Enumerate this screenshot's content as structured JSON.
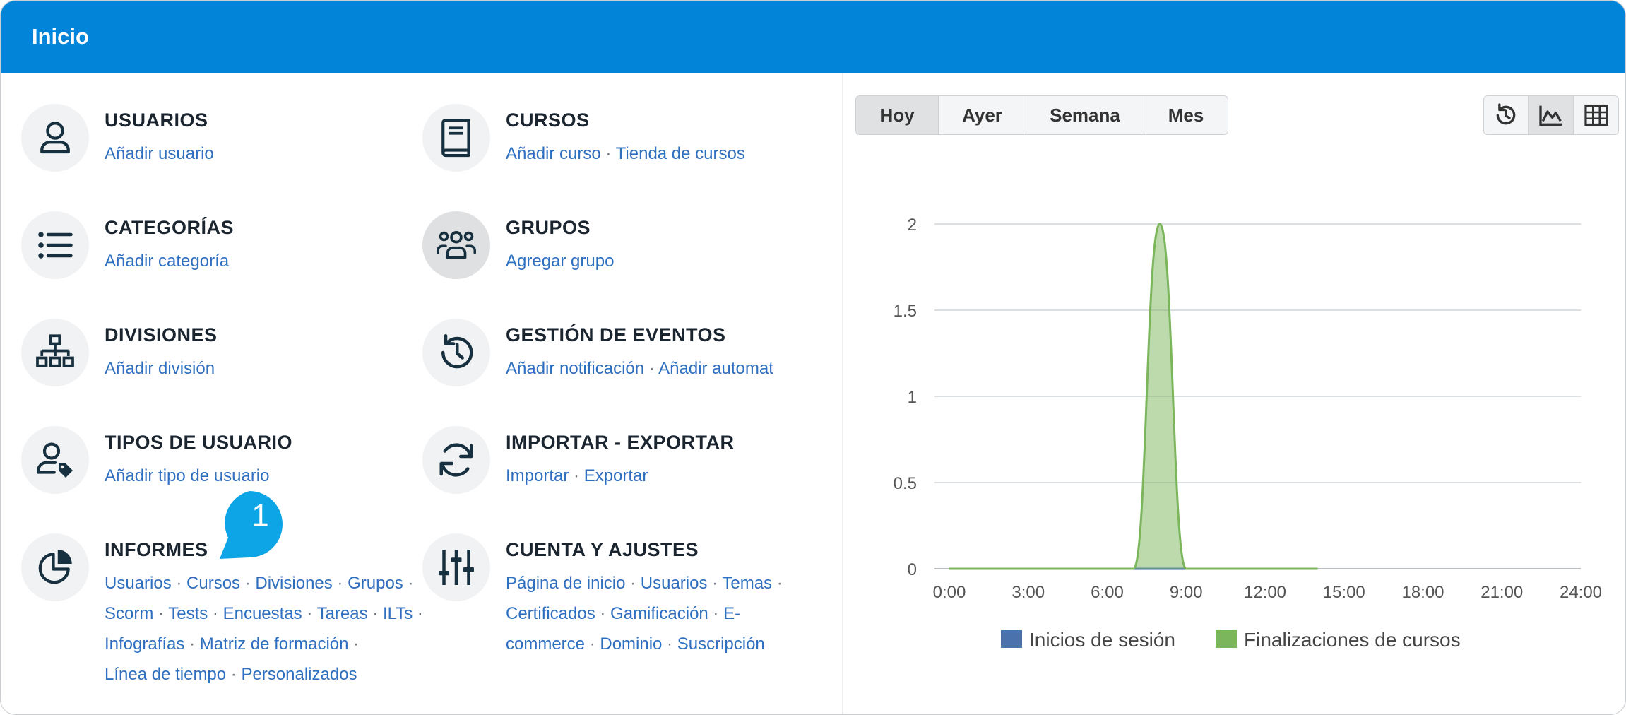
{
  "header": {
    "title": "Inicio"
  },
  "tiles": [
    {
      "title": "USUARIOS",
      "icon": "user-icon",
      "lines": [
        [
          "Añadir usuario"
        ]
      ]
    },
    {
      "title": "CATEGORÍAS",
      "icon": "list-icon",
      "lines": [
        [
          "Añadir categoría"
        ]
      ]
    },
    {
      "title": "DIVISIONES",
      "icon": "hierarchy-icon",
      "lines": [
        [
          "Añadir división"
        ]
      ]
    },
    {
      "title": "TIPOS DE USUARIO",
      "icon": "user-tag-icon",
      "lines": [
        [
          "Añadir tipo de usuario"
        ]
      ]
    },
    {
      "title": "INFORMES",
      "icon": "pie-chart-icon",
      "lines": [
        [
          "Usuarios",
          "Cursos",
          "Divisiones",
          "Grupos",
          ""
        ],
        [
          "Scorm",
          "Tests",
          "Encuestas",
          "Tareas",
          "ILTs",
          ""
        ],
        [
          "Infografías",
          "Matriz de formación",
          ""
        ],
        [
          "Línea de tiempo",
          "Personalizados"
        ]
      ]
    },
    {
      "title": "CURSOS",
      "icon": "book-icon",
      "lines": [
        [
          "Añadir curso",
          "Tienda de cursos"
        ]
      ]
    },
    {
      "title": "GRUPOS",
      "icon": "group-icon",
      "lines": [
        [
          "Agregar grupo"
        ]
      ]
    },
    {
      "title": "GESTIÓN DE EVENTOS",
      "icon": "history-icon",
      "lines": [
        [
          "Añadir notificación",
          "Añadir automat"
        ]
      ]
    },
    {
      "title": "IMPORTAR - EXPORTAR",
      "icon": "sync-icon",
      "lines": [
        [
          "Importar",
          "Exportar"
        ]
      ]
    },
    {
      "title": "CUENTA Y AJUSTES",
      "icon": "sliders-icon",
      "lines": [
        [
          "Página de inicio",
          "Usuarios",
          "Temas",
          ""
        ],
        [
          "Certificados",
          "Gamificación",
          "E-"
        ],
        [
          "commerce",
          "Dominio",
          "Suscripción"
        ]
      ]
    }
  ],
  "period_tabs": [
    "Hoy",
    "Ayer",
    "Semana",
    "Mes"
  ],
  "active_period": "Hoy",
  "view_buttons": [
    "history-icon",
    "area-chart-icon",
    "table-icon"
  ],
  "active_view": "area-chart-icon",
  "callout": {
    "number": "1"
  },
  "chart_data": {
    "type": "area",
    "title": "",
    "xlabel": "",
    "ylabel": "",
    "x_ticks": [
      "0:00",
      "3:00",
      "6:00",
      "9:00",
      "12:00",
      "15:00",
      "18:00",
      "21:00",
      "24:00"
    ],
    "y_ticks": [
      "0",
      "0.5",
      "1",
      "1.5",
      "2"
    ],
    "ylim": [
      0,
      2
    ],
    "xlim_hours": [
      0,
      24
    ],
    "grid": true,
    "legend_position": "bottom",
    "series": [
      {
        "name": "Inicios de sesión",
        "color": "#4a72ac",
        "x_hours": [
          0,
          1,
          2,
          3,
          4,
          5,
          6,
          7,
          8,
          9,
          10,
          11,
          12,
          13,
          14
        ],
        "values": [
          0,
          0,
          0,
          0,
          0,
          0,
          0,
          0,
          0,
          0,
          0,
          0,
          0,
          0,
          0
        ]
      },
      {
        "name": "Finalizaciones de cursos",
        "color": "#7cb65c",
        "x_hours": [
          0,
          1,
          2,
          3,
          4,
          5,
          6,
          7,
          8,
          9,
          10,
          11,
          12,
          13,
          14
        ],
        "values": [
          0,
          0,
          0,
          0,
          0,
          0,
          0,
          0,
          2,
          0,
          0,
          0,
          0,
          0,
          0
        ]
      }
    ]
  }
}
